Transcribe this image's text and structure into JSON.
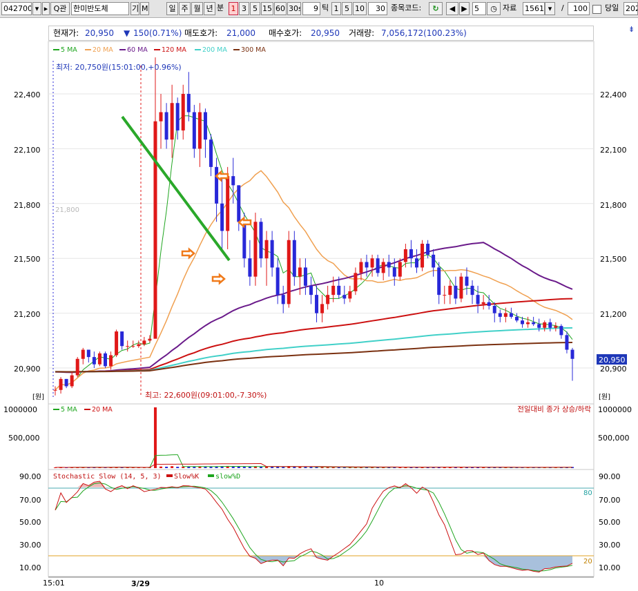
{
  "toolbar": {
    "stock_code": "042700",
    "stock_name": "한미반도체",
    "search_label": "Q",
    "related_label": "관",
    "flag_gi": "기",
    "flag_m": "M",
    "period_buttons": [
      "일",
      "주",
      "월",
      "년",
      "분"
    ],
    "minute_buttons": [
      "1",
      "3",
      "5",
      "15",
      "60",
      "30s"
    ],
    "tick_value": "9",
    "tick_label": "틱",
    "tick_buttons": [
      "1",
      "5",
      "10"
    ],
    "tick_input": "30",
    "compare_label": "종목코드:",
    "step_value": "5",
    "data_label": "자료",
    "data_count": "1561",
    "divider": "/",
    "page_size": "100",
    "today_label": "당일",
    "today_value": "202"
  },
  "status": {
    "current_label": "현재가:",
    "current_value": "20,950",
    "change": "150(0.71%)",
    "ask_label": "매도호가:",
    "ask_value": "21,000",
    "bid_label": "매수호가:",
    "bid_value": "20,950",
    "volume_label": "거래량:",
    "volume_value": "7,056,172(100.23%)"
  },
  "price_panel": {
    "ma_legend": [
      {
        "name": "5 MA",
        "color": "#1ea51e"
      },
      {
        "name": "20 MA",
        "color": "#f0a050"
      },
      {
        "name": "60 MA",
        "color": "#6a1a8a"
      },
      {
        "name": "120 MA",
        "color": "#cc1010"
      },
      {
        "name": "200 MA",
        "color": "#40d0c8"
      },
      {
        "name": "300 MA",
        "color": "#7a3010"
      }
    ],
    "low_annotation": "최저: 20,750원(15:01:00,+0.96%)",
    "high_annotation": "최고: 22,600원(09:01:00,-7.30%)",
    "ref_line_label": "21,800",
    "unit_label": "[원]",
    "last_price_tag": "20,950",
    "y_ticks": [
      "22,400",
      "22,100",
      "21,800",
      "21,500",
      "21,200",
      "20,900"
    ]
  },
  "volume_panel": {
    "legend": [
      {
        "name": "5 MA",
        "color": "#1ea51e"
      },
      {
        "name": "20 MA",
        "color": "#cc1010"
      }
    ],
    "note": "전일대비 종가 상승/하락",
    "y_ticks": [
      "1000000",
      "500,000"
    ]
  },
  "stoch_panel": {
    "title": "Stochastic Slow (14, 5, 3)",
    "k_label": "Slow%K",
    "d_label": "slow%D",
    "upper_label": "80",
    "lower_label": "20",
    "y_ticks": [
      "90.00",
      "70.00",
      "50.00",
      "30.00",
      "10.00"
    ]
  },
  "x_axis": {
    "labels": [
      "15:01",
      "3/29",
      "10"
    ]
  },
  "colors": {
    "up": "#e01818",
    "down": "#2828d8",
    "trend_line": "#2aa82a",
    "arrow": "#f07a1a"
  },
  "chart_data": {
    "type": "candlestick",
    "candles": [
      [
        20780,
        20800,
        20750,
        20780
      ],
      [
        20780,
        20850,
        20760,
        20840
      ],
      [
        20840,
        20840,
        20790,
        20800
      ],
      [
        20800,
        20880,
        20790,
        20860
      ],
      [
        20860,
        20960,
        20850,
        20950
      ],
      [
        20950,
        21010,
        20920,
        21000
      ],
      [
        21000,
        21000,
        20930,
        20960
      ],
      [
        20960,
        20990,
        20900,
        20920
      ],
      [
        20920,
        20990,
        20910,
        20980
      ],
      [
        20980,
        20990,
        20900,
        20910
      ],
      [
        20910,
        20990,
        20890,
        20970
      ],
      [
        20970,
        21110,
        20960,
        21100
      ],
      [
        21100,
        21100,
        21000,
        21020
      ],
      [
        21020,
        21050,
        20990,
        21020
      ],
      [
        21020,
        21050,
        21010,
        21020
      ],
      [
        21020,
        21050,
        21010,
        21030
      ],
      [
        21030,
        21070,
        21020,
        21050
      ],
      [
        21050,
        21080,
        21040,
        21060
      ],
      [
        21060,
        22600,
        21760,
        22250
      ],
      [
        22250,
        22400,
        22100,
        22300
      ],
      [
        22300,
        22350,
        22100,
        22150
      ],
      [
        22150,
        22450,
        22050,
        22350
      ],
      [
        22350,
        22380,
        22150,
        22200
      ],
      [
        22200,
        22450,
        22150,
        22400
      ],
      [
        22400,
        22520,
        22250,
        22300
      ],
      [
        22300,
        22340,
        22050,
        22100
      ],
      [
        22100,
        22350,
        22000,
        22300
      ],
      [
        22300,
        22320,
        22050,
        22150
      ],
      [
        22150,
        22180,
        21950,
        22000
      ],
      [
        22000,
        22050,
        21700,
        21800
      ],
      [
        21800,
        21950,
        21550,
        21650
      ],
      [
        21650,
        22000,
        21550,
        21950
      ],
      [
        21950,
        22050,
        21800,
        21900
      ],
      [
        21900,
        21900,
        21650,
        21700
      ],
      [
        21700,
        21750,
        21450,
        21500
      ],
      [
        21500,
        21600,
        21350,
        21400
      ],
      [
        21400,
        21750,
        21350,
        21700
      ],
      [
        21700,
        21720,
        21450,
        21500
      ],
      [
        21500,
        21650,
        21350,
        21600
      ],
      [
        21600,
        21650,
        21400,
        21450
      ],
      [
        21450,
        21500,
        21250,
        21300
      ],
      [
        21300,
        21350,
        21200,
        21250
      ],
      [
        21250,
        21650,
        21230,
        21600
      ],
      [
        21600,
        21650,
        21350,
        21400
      ],
      [
        21400,
        21500,
        21300,
        21450
      ],
      [
        21450,
        21500,
        21300,
        21350
      ],
      [
        21350,
        21400,
        21250,
        21300
      ],
      [
        21300,
        21350,
        21150,
        21200
      ],
      [
        21200,
        21300,
        21150,
        21250
      ],
      [
        21250,
        21350,
        21220,
        21300
      ],
      [
        21300,
        21400,
        21260,
        21350
      ],
      [
        21350,
        21400,
        21280,
        21300
      ],
      [
        21300,
        21350,
        21250,
        21280
      ],
      [
        21280,
        21350,
        21260,
        21320
      ],
      [
        21320,
        21450,
        21300,
        21420
      ],
      [
        21420,
        21500,
        21380,
        21480
      ],
      [
        21480,
        21520,
        21400,
        21450
      ],
      [
        21450,
        21520,
        21400,
        21500
      ],
      [
        21500,
        21520,
        21400,
        21420
      ],
      [
        21420,
        21500,
        21380,
        21480
      ],
      [
        21480,
        21520,
        21400,
        21450
      ],
      [
        21450,
        21500,
        21350,
        21400
      ],
      [
        21400,
        21500,
        21380,
        21480
      ],
      [
        21480,
        21580,
        21450,
        21550
      ],
      [
        21550,
        21600,
        21450,
        21500
      ],
      [
        21500,
        21550,
        21420,
        21450
      ],
      [
        21450,
        21600,
        21430,
        21580
      ],
      [
        21580,
        21600,
        21500,
        21520
      ],
      [
        21520,
        21550,
        21400,
        21450
      ],
      [
        21450,
        21480,
        21250,
        21300
      ],
      [
        21300,
        21350,
        21250,
        21300
      ],
      [
        21300,
        21380,
        21250,
        21350
      ],
      [
        21350,
        21400,
        21250,
        21280
      ],
      [
        21280,
        21420,
        21260,
        21400
      ],
      [
        21400,
        21450,
        21300,
        21350
      ],
      [
        21350,
        21380,
        21250,
        21300
      ],
      [
        21300,
        21350,
        21200,
        21250
      ],
      [
        21250,
        21300,
        21220,
        21260
      ],
      [
        21260,
        21300,
        21220,
        21240
      ],
      [
        21240,
        21260,
        21150,
        21200
      ],
      [
        21200,
        21220,
        21150,
        21180
      ],
      [
        21180,
        21230,
        21150,
        21200
      ],
      [
        21200,
        21230,
        21170,
        21180
      ],
      [
        21180,
        21200,
        21150,
        21160
      ],
      [
        21160,
        21180,
        21120,
        21140
      ],
      [
        21140,
        21180,
        21120,
        21150
      ],
      [
        21150,
        21180,
        21130,
        21140
      ],
      [
        21140,
        21170,
        21100,
        21120
      ],
      [
        21120,
        21160,
        21100,
        21150
      ],
      [
        21150,
        21170,
        21100,
        21120
      ],
      [
        21120,
        21150,
        21100,
        21130
      ],
      [
        21130,
        21140,
        21060,
        21080
      ],
      [
        21080,
        21100,
        20980,
        21000
      ],
      [
        21000,
        21010,
        20830,
        20950
      ]
    ]
  }
}
